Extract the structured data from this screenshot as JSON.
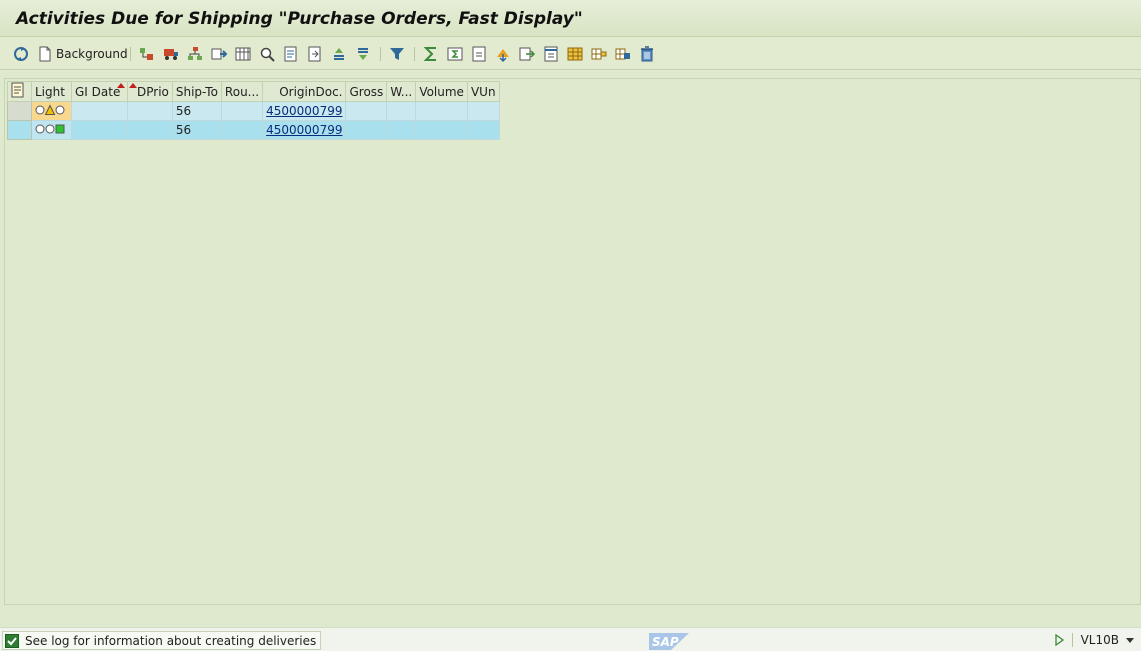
{
  "window": {
    "title": "Activities Due for Shipping \"Purchase Orders, Fast Display\""
  },
  "toolbar": {
    "background_label": "Background",
    "icons": [
      "refresh-icon",
      "document-icon",
      "select-detail-icon",
      "ship-icon",
      "hierarchy-icon",
      "forward-icon",
      "grid-icon",
      "find-icon",
      "list-left-icon",
      "list-doc-icon",
      "sort-asc-icon",
      "sort-desc-icon",
      "filter-icon",
      "sum-icon",
      "subtotal-icon",
      "total-icon",
      "export-icon",
      "export2-icon",
      "print-preview-icon",
      "layout-icon",
      "layout-change-icon",
      "layout-save-icon",
      "delete-icon"
    ]
  },
  "grid": {
    "columns": [
      "Light",
      "GI Date",
      "DPrio",
      "Ship-To",
      "Rou...",
      "OriginDoc.",
      "Gross",
      "W...",
      "Volume",
      "VUn"
    ],
    "rows": [
      {
        "light": "yellow",
        "gi_date": "",
        "dprio": "",
        "ship_to": "56",
        "route": "",
        "origin_doc": "4500000799",
        "gross": "",
        "weight_unit": "",
        "volume": "",
        "vun": ""
      },
      {
        "light": "green",
        "gi_date": "",
        "dprio": "",
        "ship_to": "56",
        "route": "",
        "origin_doc": "4500000799",
        "gross": "",
        "weight_unit": "",
        "volume": "",
        "vun": ""
      }
    ]
  },
  "status": {
    "message": "See log for information about creating deliveries",
    "logo": "SAP",
    "transaction": "VL10B"
  },
  "colors": {
    "background": "#dfe9cd",
    "row_selected": "#a9e0ee",
    "row_normal": "#c9e8ef",
    "link": "#0a2c7a",
    "sort_marker": "#c0201f"
  }
}
